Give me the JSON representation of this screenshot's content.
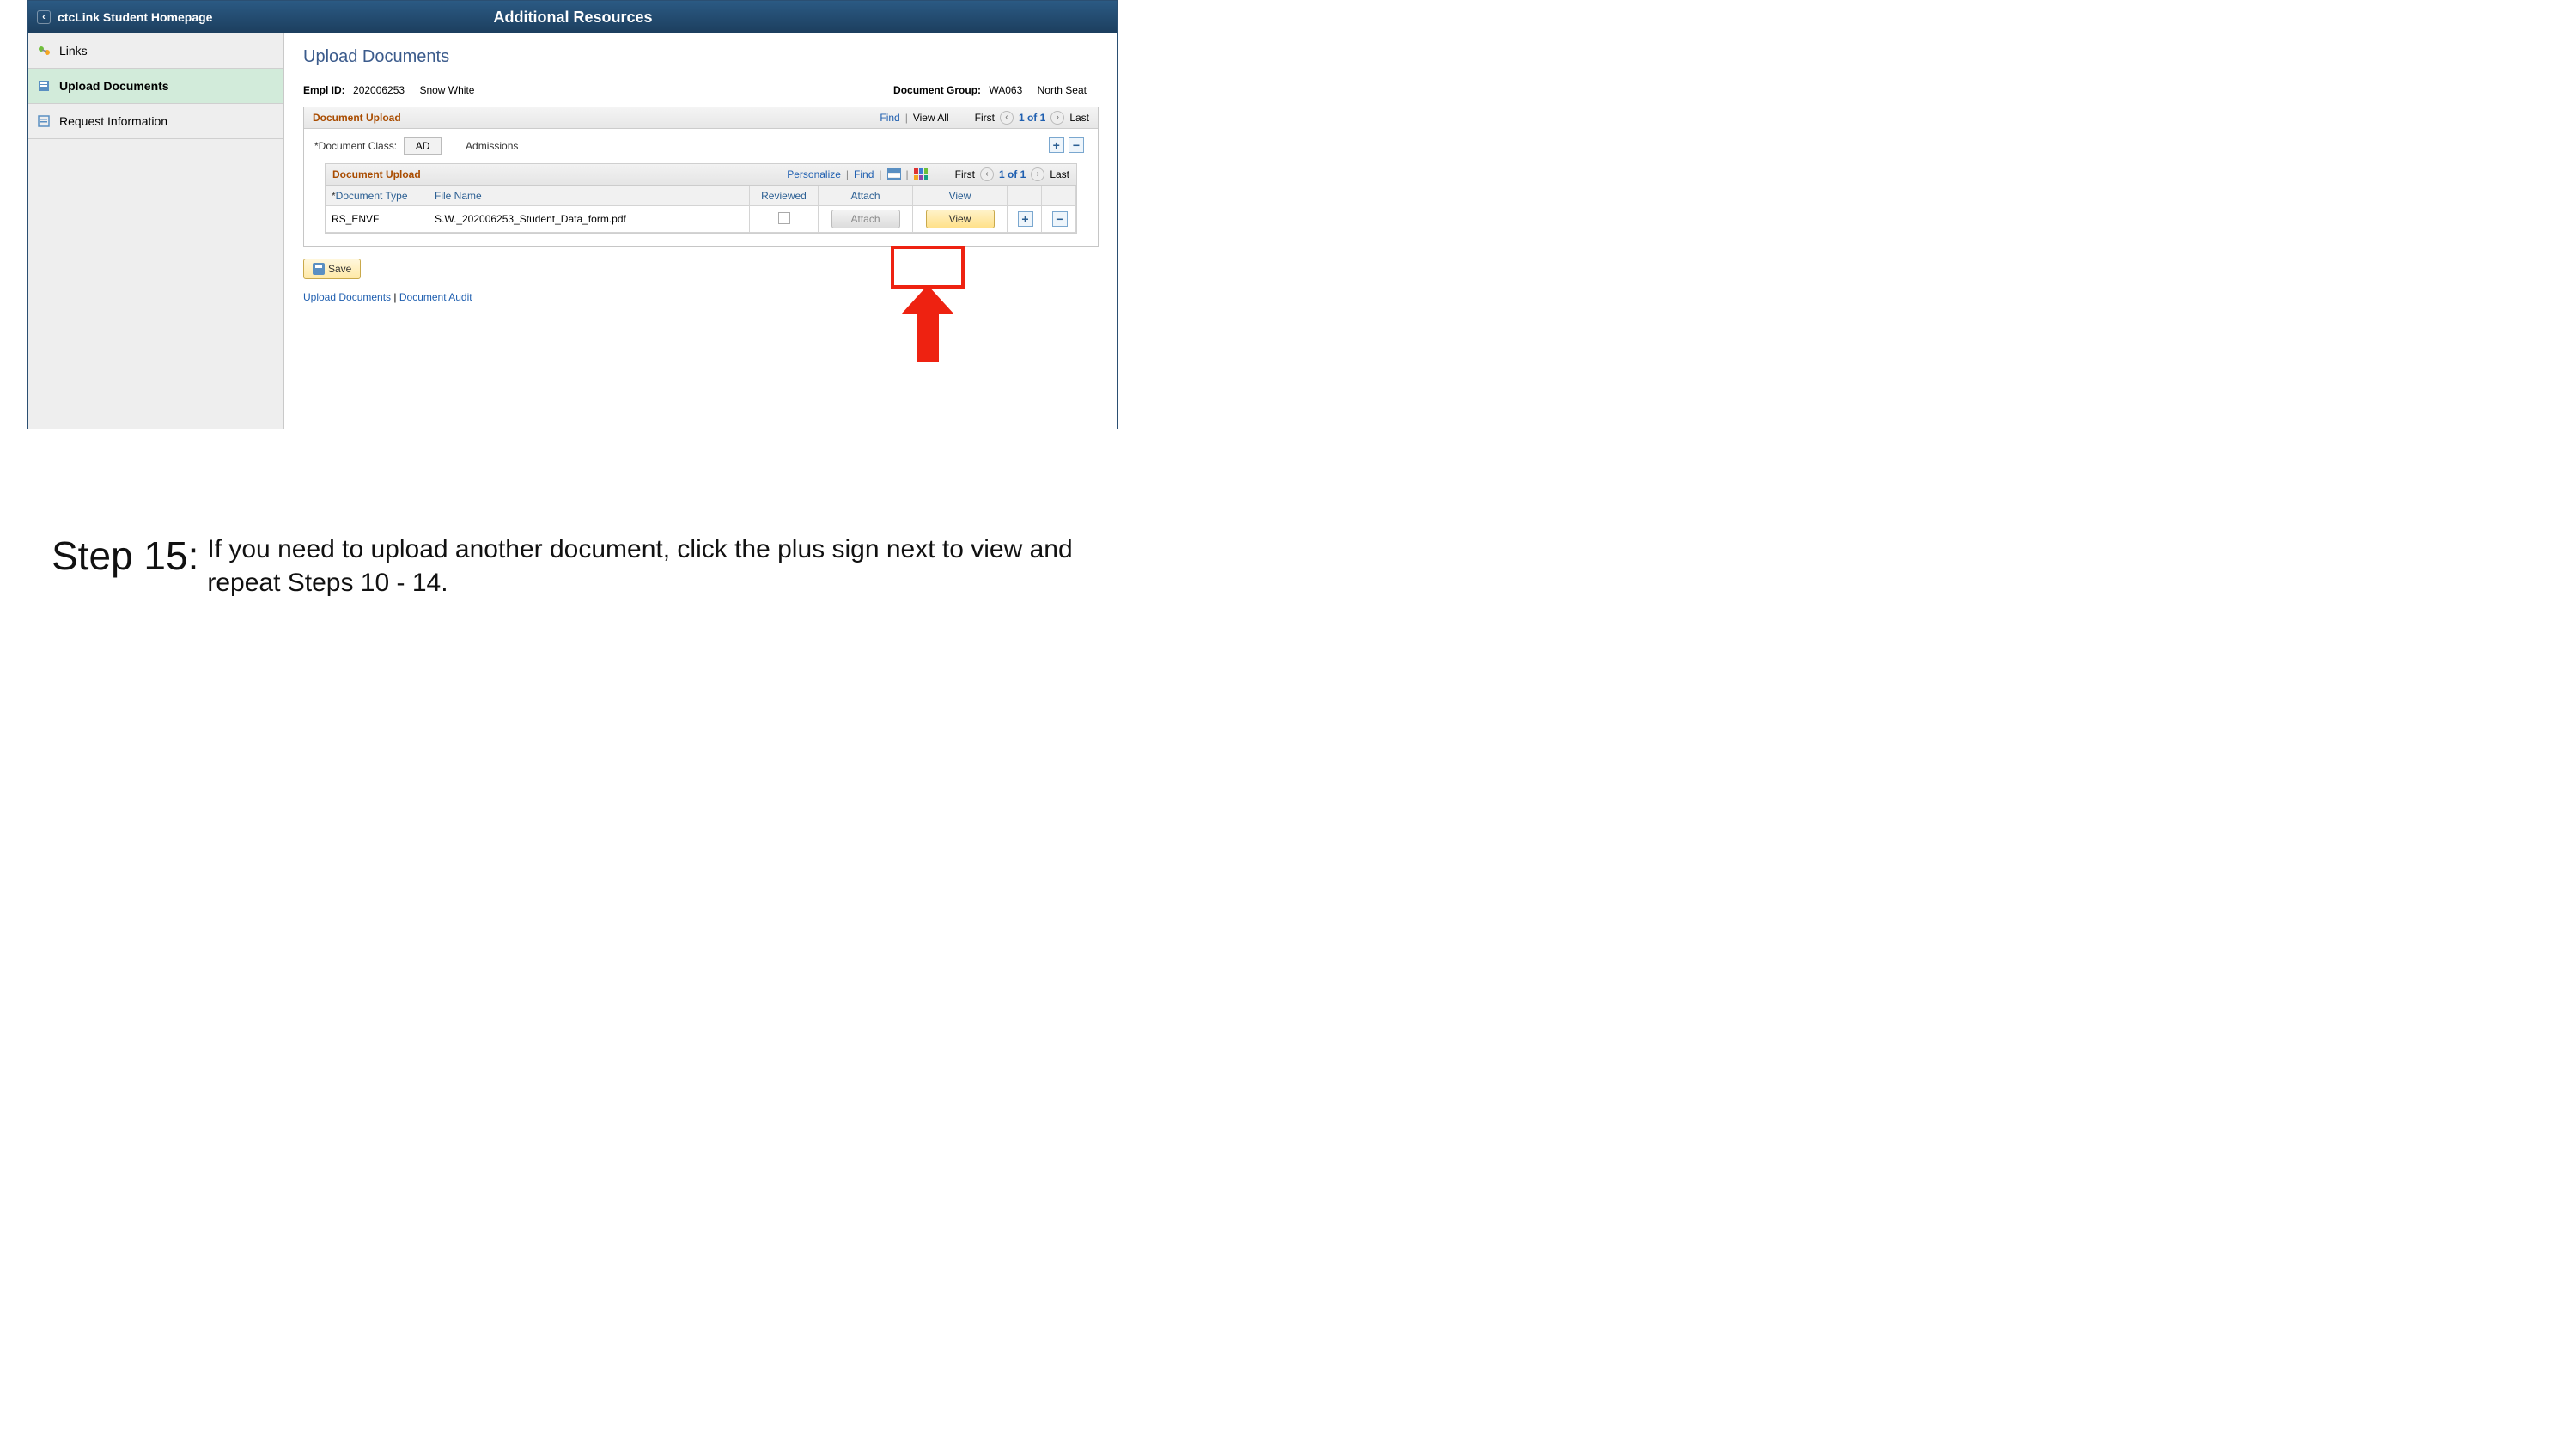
{
  "topbar": {
    "back_label": "ctcLink Student Homepage",
    "title": "Additional Resources"
  },
  "sidebar": {
    "items": [
      {
        "label": "Links"
      },
      {
        "label": "Upload Documents"
      },
      {
        "label": "Request Information"
      }
    ]
  },
  "page": {
    "title": "Upload Documents",
    "empl_id_label": "Empl ID:",
    "empl_id": "202006253",
    "empl_name": "Snow White",
    "doc_group_label": "Document Group:",
    "doc_group_code": "WA063",
    "doc_group_name": "North Seat"
  },
  "outer_panel": {
    "title": "Document Upload",
    "find": "Find",
    "view_all": "View All",
    "first": "First",
    "counter": "1 of 1",
    "last": "Last",
    "doc_class_label": "Document Class:",
    "doc_class_value": "AD",
    "doc_class_desc": "Admissions"
  },
  "inner_panel": {
    "title": "Document Upload",
    "personalize": "Personalize",
    "find": "Find",
    "first": "First",
    "counter": "1 of 1",
    "last": "Last",
    "columns": {
      "doc_type": "Document Type",
      "file_name": "File Name",
      "reviewed": "Reviewed",
      "attach": "Attach",
      "view": "View"
    },
    "rows": [
      {
        "doc_type": "RS_ENVF",
        "file_name": "S.W._202006253_Student_Data_form.pdf",
        "attach_label": "Attach",
        "view_label": "View"
      }
    ]
  },
  "buttons": {
    "save": "Save",
    "plus": "+",
    "minus": "−"
  },
  "bottom_links": {
    "upload_docs": "Upload Documents",
    "audit": "Document Audit"
  },
  "instruction": {
    "step": "Step 15:",
    "text": "If you need to upload another document, click the plus sign next to view and repeat Steps 10 - 14."
  }
}
